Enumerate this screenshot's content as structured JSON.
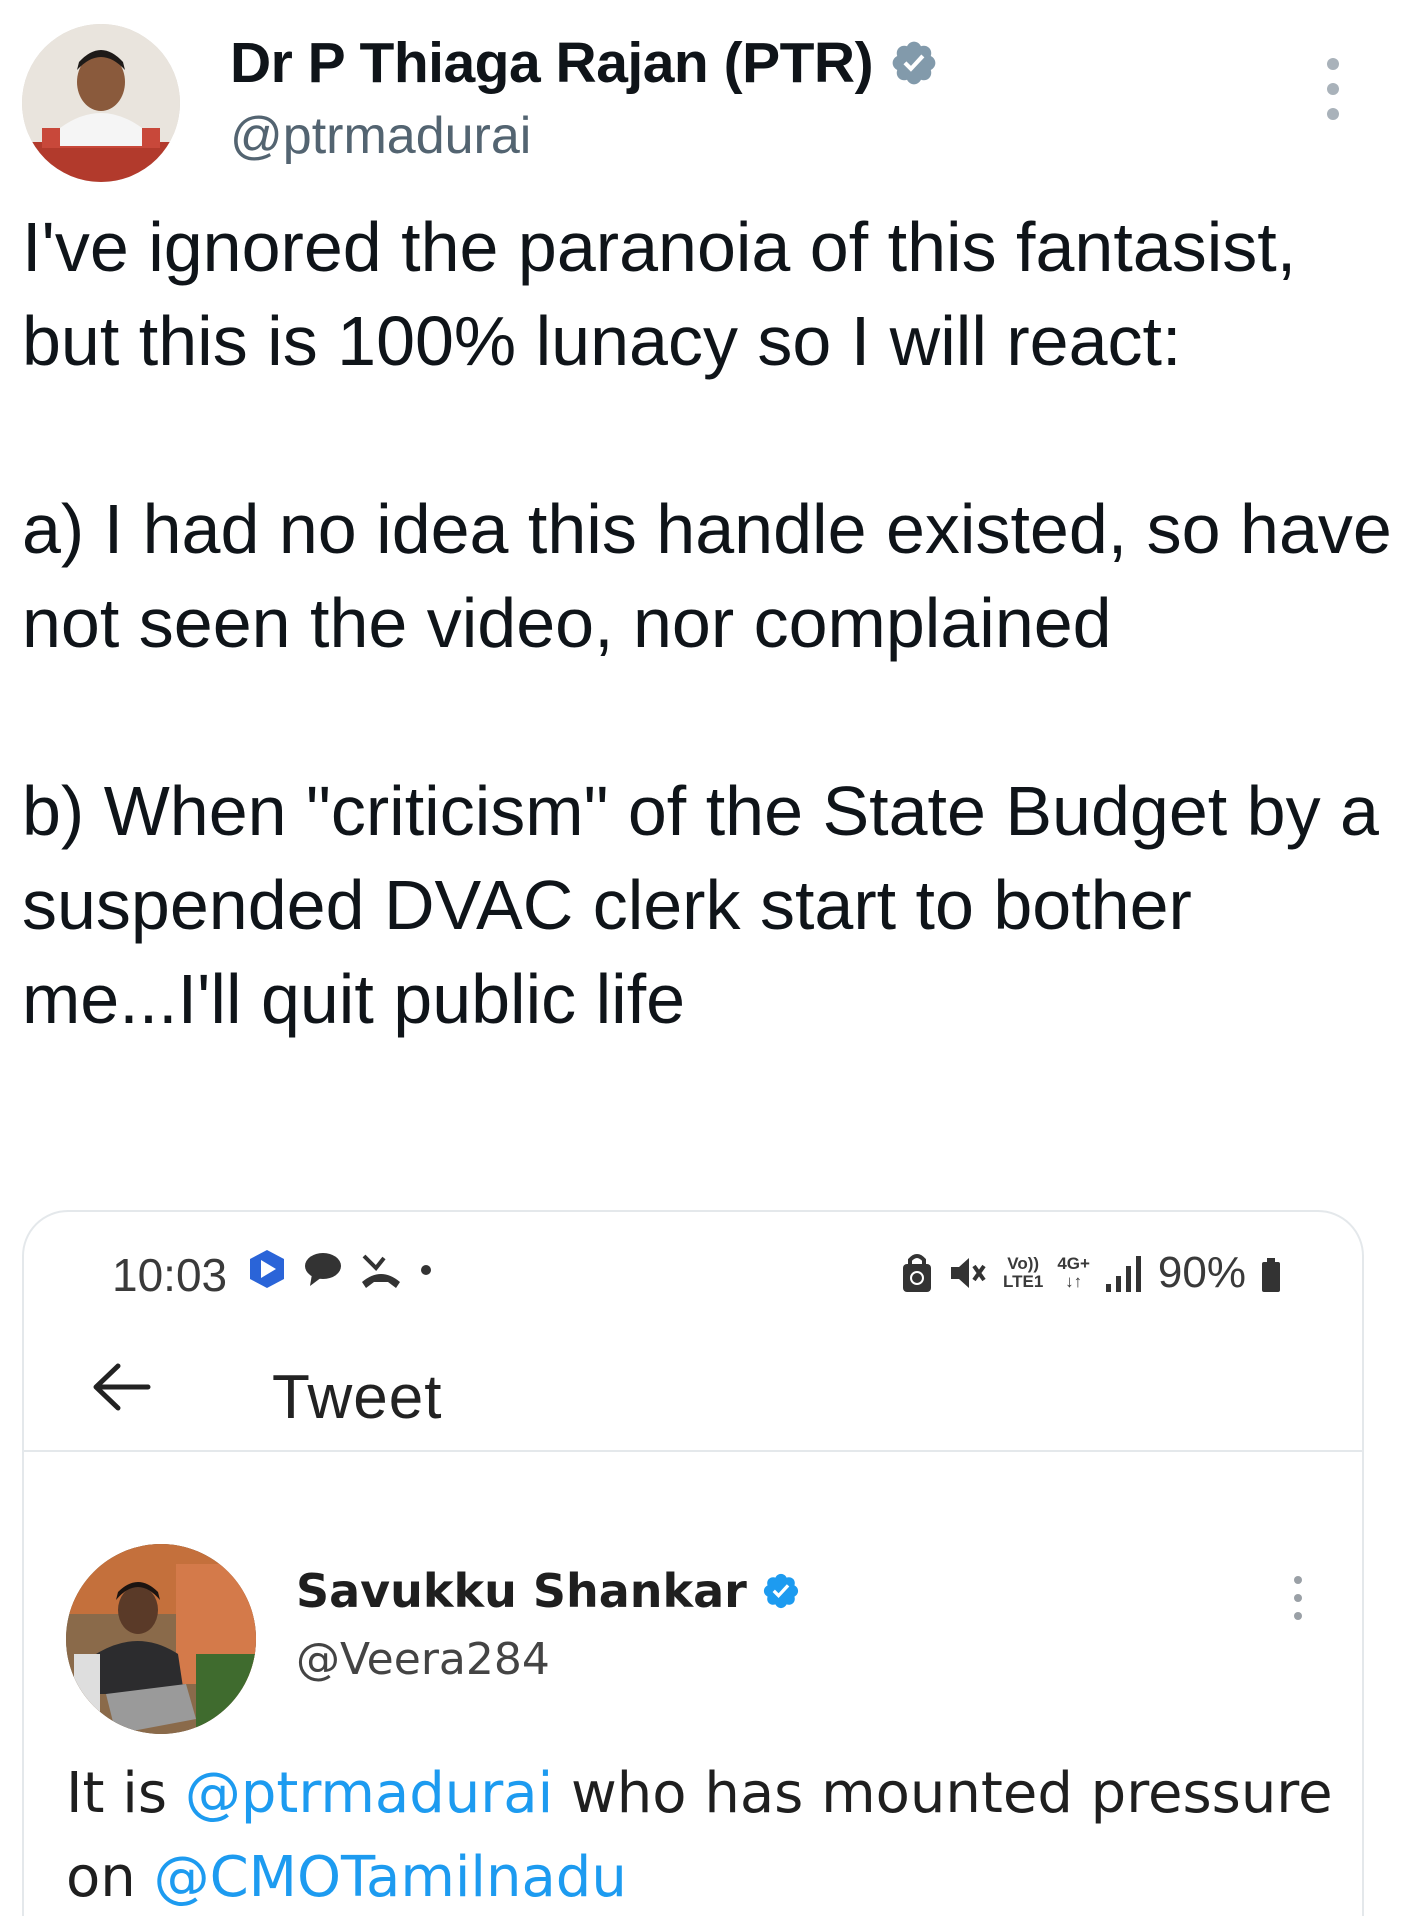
{
  "tweet": {
    "author_name": "Dr P Thiaga Rajan (PTR)",
    "author_handle": "@ptrmadurai",
    "verified_color": "#829aab",
    "text": {
      "p1": "I've ignored the paranoia of this fantasist, but this is 100% lunacy so I will react:",
      "p2": "a) I had no idea this handle existed, so have not seen the video, nor complained",
      "p3": "b) When \"criticism\" of the State  Budget by a suspended DVAC clerk start to bother me...I'll quit public life"
    }
  },
  "embedded_screenshot": {
    "status_bar": {
      "time": "10:03",
      "battery": "90%",
      "network_top": "Vo))",
      "network_bottom": "LTE1",
      "network_type": "4G+",
      "network_arrows": "↓↑"
    },
    "app_bar": {
      "title": "Tweet"
    },
    "quoted": {
      "author_name": "Savukku Shankar",
      "author_handle": "@Veera284",
      "verified_color": "#1d9bf0",
      "text_part1": "It is ",
      "mention1": "@ptrmadurai",
      "text_part2": " who has mounted pressure on ",
      "mention2": "@CMOTamilnadu"
    }
  },
  "colors": {
    "text": "#0f1419",
    "secondary": "#536471",
    "link": "#1d9bf0",
    "border": "#e4e8eb"
  }
}
